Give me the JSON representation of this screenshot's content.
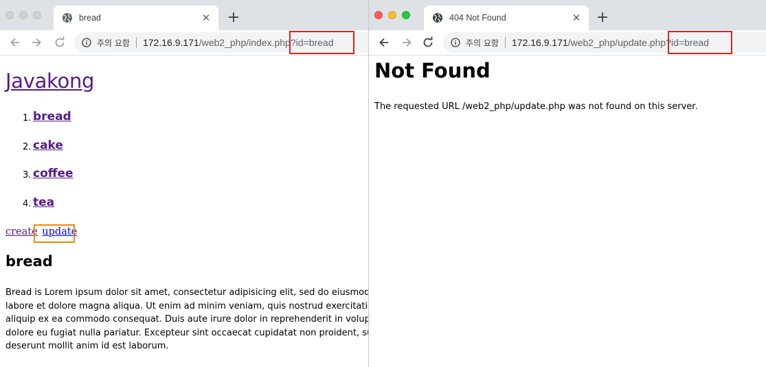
{
  "left_window": {
    "tab": {
      "title": "bread",
      "icon": "globe-icon",
      "close": "✕"
    },
    "new_tab": "+",
    "address_bar": {
      "security_label": "주의 요함",
      "host": "172.16.9.171",
      "path": "/web2_php/index.php?id=bread"
    },
    "page": {
      "site_title": "Javakong",
      "topics": [
        {
          "number": "1.",
          "label": "bread"
        },
        {
          "number": "2.",
          "label": "cake"
        },
        {
          "number": "3.",
          "label": "coffee"
        },
        {
          "number": "4.",
          "label": "tea"
        }
      ],
      "create_link": "create",
      "update_link": "update",
      "article_title": "bread",
      "article_body": "Bread is Lorem ipsum dolor sit amet, consectetur adipisicing elit, sed do eiusmod tempor incididunt ut labore et dolore magna aliqua. Ut enim ad minim veniam, quis nostrud exercitation ullamco laboris nisi ut aliquip ex ea commodo consequat. Duis aute irure dolor in reprehenderit in voluptate velit esse cillum dolore eu fugiat nulla pariatur. Excepteur sint occaecat cupidatat non proident, sunt in culpa qui officia deserunt mollit anim id est laborum."
    }
  },
  "right_window": {
    "tab": {
      "title": "404 Not Found",
      "icon": "globe-icon",
      "close": "✕"
    },
    "new_tab": "+",
    "address_bar": {
      "security_label": "주의 요함",
      "host": "172.16.9.171",
      "path": "/web2_php/update.php?id=bread"
    },
    "page": {
      "heading": "Not Found",
      "message": "The requested URL /web2_php/update.php was not found on this server."
    }
  },
  "colors": {
    "highlight_red": "#e2231a",
    "highlight_orange": "#f18a00",
    "visited_link": "#551a8b",
    "link": "#0000ee"
  }
}
